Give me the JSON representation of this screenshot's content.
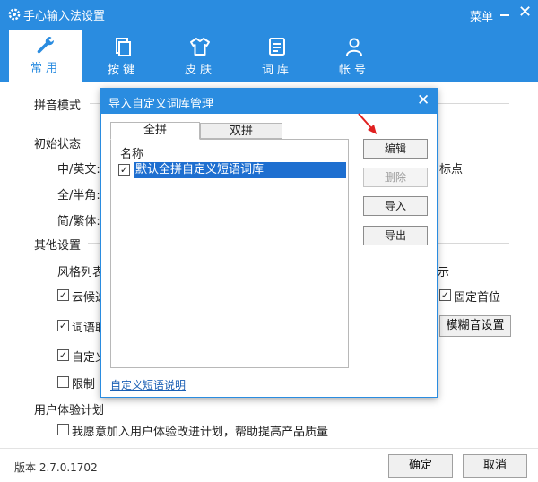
{
  "window": {
    "title": "手心输入法设置",
    "menu_label": "菜单",
    "close_label": "✕"
  },
  "tabs": [
    {
      "label": "常用",
      "icon": "wrench-icon",
      "active": true
    },
    {
      "label": "按键",
      "icon": "keyboard-icon",
      "active": false
    },
    {
      "label": "皮肤",
      "icon": "shirt-icon",
      "active": false
    },
    {
      "label": "词库",
      "icon": "dictionary-icon",
      "active": false
    },
    {
      "label": "帐号",
      "icon": "user-icon",
      "active": false
    }
  ],
  "main": {
    "pinyin_mode": "拼音模式",
    "initial_state": "初始状态",
    "cn_en": "中/英文:",
    "full_half": "全/半角:",
    "simp_trad": "简/繁体:",
    "punct_partial": "标点",
    "other_settings": "其他设置",
    "style_list_partial": "风格列表",
    "right_partial": "示",
    "cloud_partial": "云候选",
    "fixed_first": "固定首位",
    "word_partial": "词语联",
    "fuzzy_button": "模糊音设置",
    "custom_partial": "自定义",
    "limit_partial": "限制",
    "ux_plan": "用户体验计划",
    "ux_join": "我愿意加入用户体验改进计划，帮助提高产品质量",
    "checks": {
      "cloud": true,
      "fixed_first": true,
      "word": true,
      "custom": true,
      "limit": false,
      "ux_join": false
    }
  },
  "footer": {
    "version": "版本 2.7.0.1702",
    "ok": "确定",
    "cancel": "取消"
  },
  "dialog": {
    "title": "导入自定义词库管理",
    "close_label": "✕",
    "tab_full": "全拼",
    "tab_double": "双拼",
    "column_name": "名称",
    "item": "默认全拼自定义短语词库",
    "item_checked": true,
    "buttons": {
      "edit": "编辑",
      "delete": "删除",
      "import": "导入",
      "export": "导出"
    },
    "link": "自定义短语说明"
  },
  "colors": {
    "accent": "#2a8ce0",
    "selection": "#1e6fd0",
    "arrow": "#e02020"
  }
}
